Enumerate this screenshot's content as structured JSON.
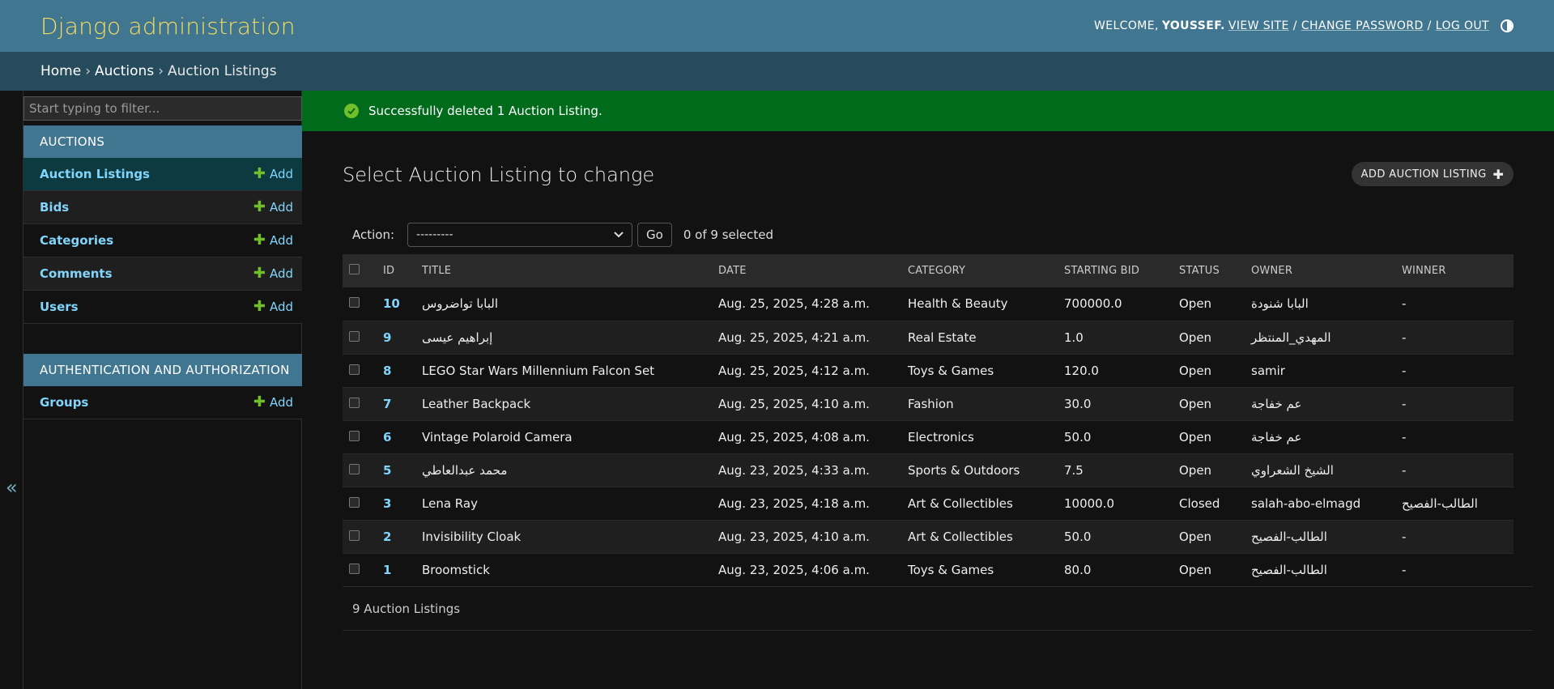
{
  "header": {
    "branding": "Django administration",
    "welcome": "WELCOME,",
    "username": "YOUSSEF.",
    "view_site": "VIEW SITE",
    "change_password": "CHANGE PASSWORD",
    "log_out": "LOG OUT",
    "separator": "/"
  },
  "breadcrumbs": {
    "home": "Home",
    "app": "Auctions",
    "current": "Auction Listings",
    "separator": "›"
  },
  "sidebar": {
    "filter_placeholder": "Start typing to filter...",
    "collapse_label": "«",
    "modules": [
      {
        "caption": "AUCTIONS",
        "items": [
          {
            "label": "Auction Listings",
            "add": "Add"
          },
          {
            "label": "Bids",
            "add": "Add"
          },
          {
            "label": "Categories",
            "add": "Add"
          },
          {
            "label": "Comments",
            "add": "Add"
          },
          {
            "label": "Users",
            "add": "Add"
          }
        ]
      },
      {
        "caption": "AUTHENTICATION AND AUTHORIZATION",
        "items": [
          {
            "label": "Groups",
            "add": "Add"
          }
        ]
      }
    ],
    "add_symbol": "✚"
  },
  "message": {
    "text": "Successfully deleted 1 Auction Listing."
  },
  "main": {
    "title": "Select Auction Listing to change",
    "add_button": "ADD AUCTION LISTING",
    "add_button_icon": "✚",
    "action_label": "Action:",
    "action_selected": "---------",
    "go_label": "Go",
    "selection_count": "0 of 9 selected",
    "columns": [
      "ID",
      "TITLE",
      "DATE",
      "CATEGORY",
      "STARTING BID",
      "STATUS",
      "OWNER",
      "WINNER"
    ],
    "rows": [
      {
        "id": "10",
        "title": "البابا تواضروس",
        "date": "Aug. 25, 2025, 4:28 a.m.",
        "category": "Health & Beauty",
        "bid": "700000.0",
        "status": "Open",
        "owner": "البابا شنودة",
        "winner": "-"
      },
      {
        "id": "9",
        "title": "إبراهيم عيسى",
        "date": "Aug. 25, 2025, 4:21 a.m.",
        "category": "Real Estate",
        "bid": "1.0",
        "status": "Open",
        "owner": "المهدي_المنتظر",
        "winner": "-"
      },
      {
        "id": "8",
        "title": "LEGO Star Wars Millennium Falcon Set",
        "date": "Aug. 25, 2025, 4:12 a.m.",
        "category": "Toys & Games",
        "bid": "120.0",
        "status": "Open",
        "owner": "samir",
        "winner": "-"
      },
      {
        "id": "7",
        "title": "Leather Backpack",
        "date": "Aug. 25, 2025, 4:10 a.m.",
        "category": "Fashion",
        "bid": "30.0",
        "status": "Open",
        "owner": "عم خفاجة",
        "winner": "-"
      },
      {
        "id": "6",
        "title": "Vintage Polaroid Camera",
        "date": "Aug. 25, 2025, 4:08 a.m.",
        "category": "Electronics",
        "bid": "50.0",
        "status": "Open",
        "owner": "عم خفاجة",
        "winner": "-"
      },
      {
        "id": "5",
        "title": "محمد عبدالعاطي",
        "date": "Aug. 23, 2025, 4:33 a.m.",
        "category": "Sports & Outdoors",
        "bid": "7.5",
        "status": "Open",
        "owner": "الشيخ الشعراوي",
        "winner": "-"
      },
      {
        "id": "3",
        "title": "Lena Ray",
        "date": "Aug. 23, 2025, 4:18 a.m.",
        "category": "Art & Collectibles",
        "bid": "10000.0",
        "status": "Closed",
        "owner": "salah-abo-elmagd",
        "winner": "الطالب-الفصيح"
      },
      {
        "id": "2",
        "title": "Invisibility Cloak",
        "date": "Aug. 23, 2025, 4:10 a.m.",
        "category": "Art & Collectibles",
        "bid": "50.0",
        "status": "Open",
        "owner": "الطالب-الفصيح",
        "winner": "-"
      },
      {
        "id": "1",
        "title": "Broomstick",
        "date": "Aug. 23, 2025, 4:06 a.m.",
        "category": "Toys & Games",
        "bid": "80.0",
        "status": "Open",
        "owner": "الطالب-الفصيح",
        "winner": "-"
      }
    ],
    "paginator": "9 Auction Listings"
  },
  "colors": {
    "header_bg": "#417690",
    "breadcrumbs_bg": "#264b5d",
    "branding": "#f5dd5d",
    "link": "#81d4fa",
    "success_bg": "#006b1b",
    "add_plus": "#70bf2b"
  }
}
